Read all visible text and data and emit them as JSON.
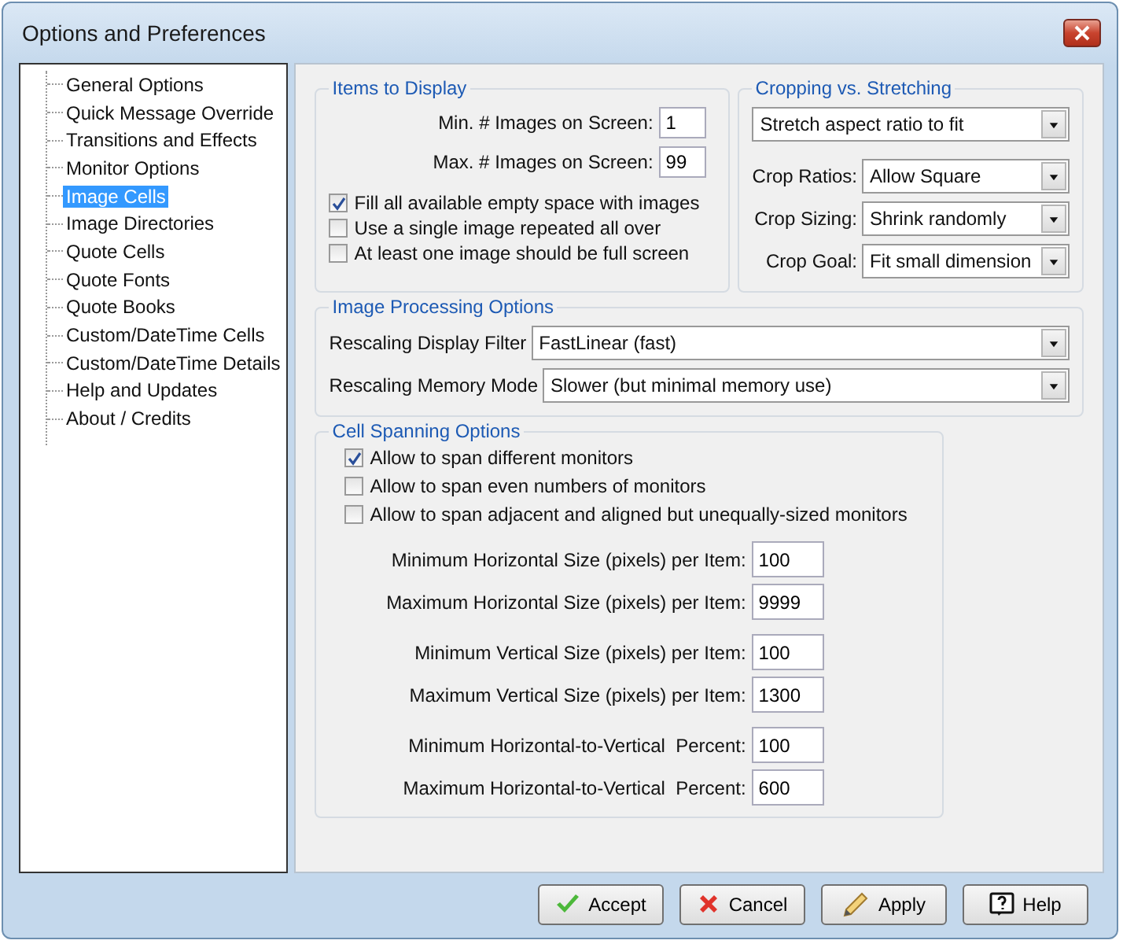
{
  "window": {
    "title": "Options and Preferences"
  },
  "sidebar": {
    "items": [
      {
        "label": "General Options",
        "selected": false
      },
      {
        "label": "Quick Message Override",
        "selected": false
      },
      {
        "label": "Transitions and Effects",
        "selected": false
      },
      {
        "label": "Monitor Options",
        "selected": false
      },
      {
        "label": "Image Cells",
        "selected": true
      },
      {
        "label": "Image Directories",
        "selected": false
      },
      {
        "label": "Quote Cells",
        "selected": false
      },
      {
        "label": "Quote Fonts",
        "selected": false
      },
      {
        "label": "Quote Books",
        "selected": false
      },
      {
        "label": "Custom/DateTime Cells",
        "selected": false
      },
      {
        "label": "Custom/DateTime Details",
        "selected": false
      },
      {
        "label": "Help and Updates",
        "selected": false
      },
      {
        "label": "About / Credits",
        "selected": false
      }
    ]
  },
  "items_to_display": {
    "title": "Items to Display",
    "fields": [
      {
        "label": "Min. # Images on Screen:",
        "value": "1"
      },
      {
        "label": "Max. # Images on Screen:",
        "value": "99"
      }
    ],
    "checkboxes": [
      {
        "label": "Fill all available empty space with images",
        "checked": true
      },
      {
        "label": "Use a single image repeated all over",
        "checked": false
      },
      {
        "label": "At least one image should be full screen",
        "checked": false
      }
    ]
  },
  "cropping": {
    "title": "Cropping vs. Stretching",
    "mode": "Stretch aspect ratio to fit",
    "selects": [
      {
        "label": "Crop Ratios:",
        "value": "Allow Square"
      },
      {
        "label": "Crop Sizing:",
        "value": "Shrink randomly"
      },
      {
        "label": "Crop Goal:",
        "value": "Fit small dimension"
      }
    ]
  },
  "image_processing": {
    "title": "Image Processing Options",
    "selects": [
      {
        "label": "Rescaling Display Filter",
        "value": "FastLinear (fast)"
      },
      {
        "label": "Rescaling Memory Mode",
        "value": "Slower (but minimal memory use)"
      }
    ]
  },
  "cell_spanning": {
    "title": "Cell Spanning Options",
    "checkboxes": [
      {
        "label": "Allow to span different monitors",
        "checked": true
      },
      {
        "label": "Allow to span even numbers of monitors",
        "checked": false
      },
      {
        "label": "Allow to span adjacent and aligned but unequally-sized monitors",
        "checked": false
      }
    ],
    "fields": [
      {
        "label": "Minimum Horizontal Size (pixels) per Item:",
        "value": "100"
      },
      {
        "label": "Maximum Horizontal Size (pixels) per Item:",
        "value": "9999"
      },
      {
        "label": "Minimum Vertical Size (pixels) per Item:",
        "value": "100"
      },
      {
        "label": "Maximum Vertical Size (pixels) per Item:",
        "value": "1300"
      },
      {
        "label": "Minimum Horizontal-to-Vertical  Percent:",
        "value": "100"
      },
      {
        "label": "Maximum Horizontal-to-Vertical  Percent:",
        "value": "600"
      }
    ]
  },
  "buttons": [
    {
      "label": "Accept",
      "kind": "accept"
    },
    {
      "label": "Cancel",
      "kind": "cancel"
    },
    {
      "label": "Apply",
      "kind": "apply"
    },
    {
      "label": "Help",
      "kind": "help"
    }
  ]
}
